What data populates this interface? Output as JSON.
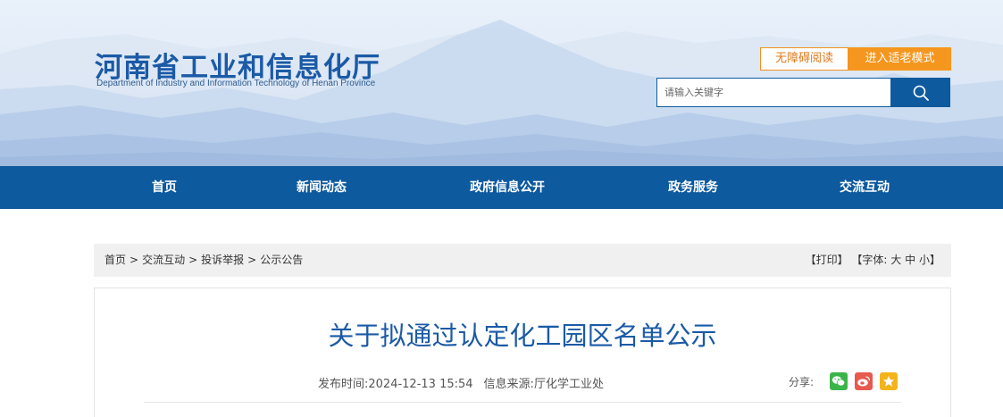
{
  "header": {
    "title": "河南省工业和信息化厅",
    "subtitle": "Department of Industry and Information Technology of Henan Province",
    "accessible_label": "无障碍阅读",
    "elder_mode_label": "进入适老模式",
    "search": {
      "placeholder": "请输入关键字"
    }
  },
  "nav": {
    "items": [
      {
        "label": "首页"
      },
      {
        "label": "新闻动态"
      },
      {
        "label": "政府信息公开"
      },
      {
        "label": "政务服务"
      },
      {
        "label": "交流互动"
      }
    ]
  },
  "breadcrumb": {
    "items": [
      "首页",
      "交流互动",
      "投诉举报",
      "公示公告"
    ],
    "separator": ">"
  },
  "tools": {
    "print": "【打印】",
    "font_prefix": "【字体:",
    "font_large": "大",
    "font_medium": "中",
    "font_small": "小",
    "font_suffix": "】"
  },
  "article": {
    "title": "关于拟通过认定化工园区名单公示",
    "publish_label": "发布时间:",
    "publish_time": "2024-12-13 15:54",
    "source_label": "信息来源:",
    "source": "厅化学工业处",
    "share_label": "分享:"
  },
  "colors": {
    "brand_blue": "#0e5a9f",
    "title_blue": "#1b5aa6",
    "accent_orange": "#f5961f",
    "wechat_green": "#3bb54a",
    "weibo_red": "#e8594e",
    "favorite_yellow": "#f3b41b"
  },
  "icons": [
    "search-icon",
    "wechat-icon",
    "weibo-icon",
    "star-icon"
  ]
}
